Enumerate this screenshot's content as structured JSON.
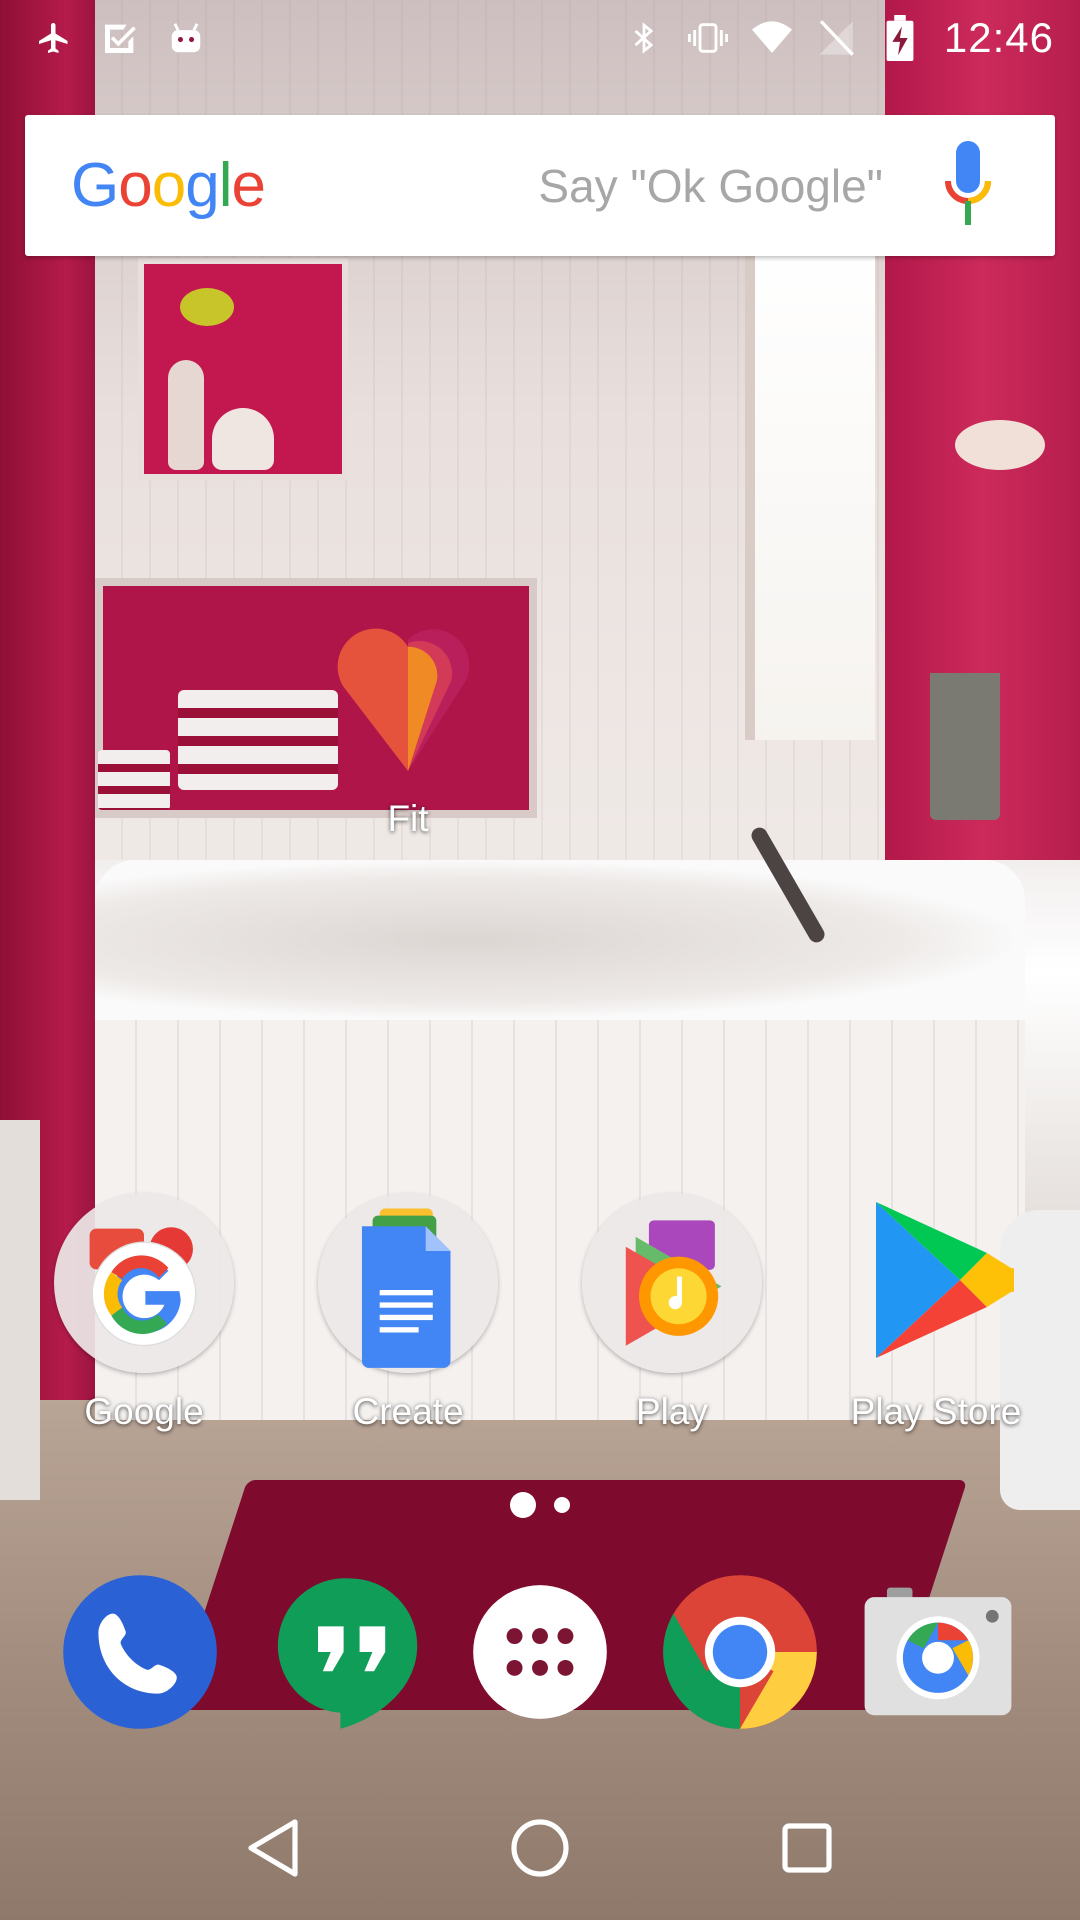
{
  "status_bar": {
    "time": "12:46",
    "icons_left": [
      "airplane-icon",
      "check-box-icon",
      "android-icon"
    ],
    "icons_right": [
      "bluetooth-icon",
      "vibrate-icon",
      "wifi-icon",
      "no-sim-icon",
      "battery-charging-icon"
    ]
  },
  "search": {
    "logo_letters": [
      "G",
      "o",
      "o",
      "g",
      "l",
      "e"
    ],
    "logo_colors": [
      "#4285F4",
      "#EA4335",
      "#FBBC05",
      "#4285F4",
      "#34A853",
      "#EA4335"
    ],
    "hint": "Say \"Ok Google\""
  },
  "home": {
    "fit": {
      "label": "Fit"
    },
    "row": [
      {
        "label": "Google"
      },
      {
        "label": "Create"
      },
      {
        "label": "Play"
      },
      {
        "label": "Play Store"
      }
    ]
  },
  "page_indicator": {
    "pages": 2,
    "current": 1
  },
  "dock": [
    "phone-icon",
    "hangouts-icon",
    "app-drawer-icon",
    "chrome-icon",
    "camera-icon"
  ],
  "nav": [
    "back-icon",
    "home-icon",
    "recents-icon"
  ]
}
